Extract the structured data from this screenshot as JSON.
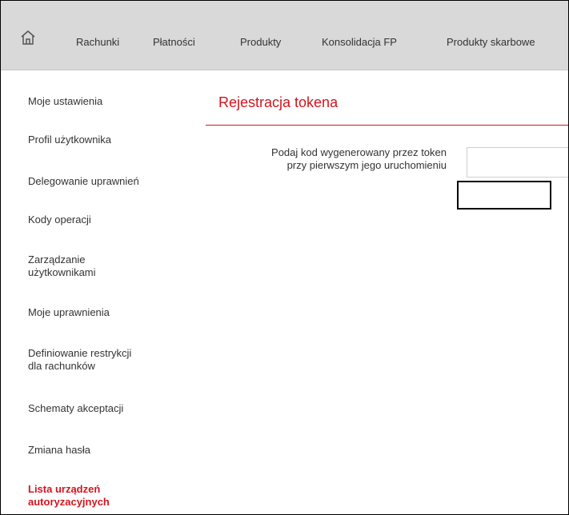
{
  "topnav": {
    "home_icon": "home-icon",
    "items": [
      "Rachunki",
      "Płatności",
      "Produkty",
      "Konsolidacja FP",
      "Produkty skarbowe"
    ]
  },
  "sidebar": {
    "items": [
      {
        "line1": "Moje ustawienia",
        "line2": ""
      },
      {
        "line1": "Profil użytkownika",
        "line2": ""
      },
      {
        "line1": "Delegowanie uprawnień",
        "line2": ""
      },
      {
        "line1": "Kody operacji",
        "line2": ""
      },
      {
        "line1": "Zarządzanie",
        "line2": "użytkownikami"
      },
      {
        "line1": "Moje uprawnienia",
        "line2": ""
      },
      {
        "line1": "Definiowanie restrykcji",
        "line2": "dla rachunków"
      },
      {
        "line1": "Schematy akceptacji",
        "line2": ""
      },
      {
        "line1": "Zmiana hasła",
        "line2": ""
      },
      {
        "line1": "Lista urządzeń",
        "line2": "autoryzacyjnych"
      }
    ]
  },
  "main": {
    "title": "Rejestracja tokena",
    "form_label_line1": "Podaj kod wygenerowany przez token",
    "form_label_line2": "przy pierwszym jego uruchomieniu",
    "token_value": ""
  },
  "colors": {
    "accent": "#d5141e",
    "nav_bg": "#d9d9d9"
  }
}
